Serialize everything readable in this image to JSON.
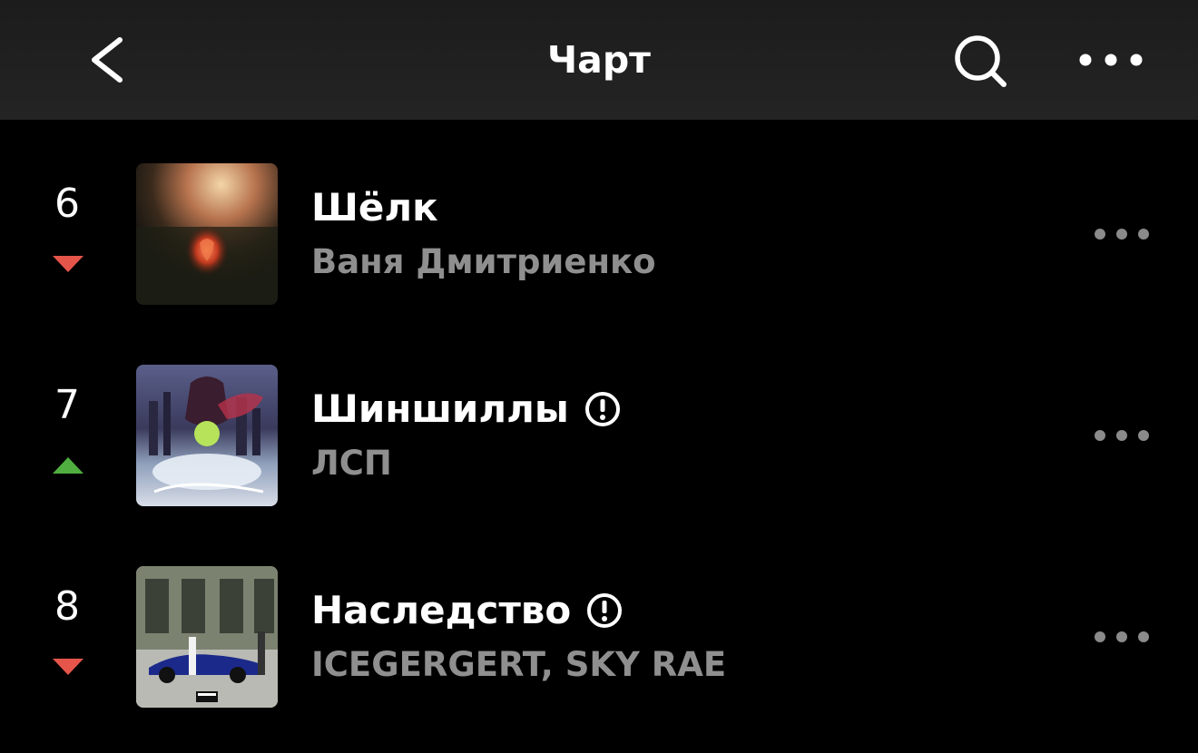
{
  "header": {
    "title": "Чарт",
    "back_icon": "chevron-left-icon",
    "search_icon": "search-icon",
    "more_icon": "more-horizontal-icon"
  },
  "tracks": [
    {
      "position": "6",
      "trend": "down",
      "title": "Шёлк",
      "artist": "Ваня Дмитриенко",
      "explicit": false
    },
    {
      "position": "7",
      "trend": "up",
      "title": "Шиншиллы",
      "artist": "ЛСП",
      "explicit": true
    },
    {
      "position": "8",
      "trend": "down",
      "title": "Наследство",
      "artist": "ICEGERGERT, SKY RAE",
      "explicit": true
    }
  ],
  "colors": {
    "background": "#000000",
    "header": "#1f1f1f",
    "text_primary": "#ffffff",
    "text_secondary": "#8f8f8f",
    "trend_down": "#e5554a",
    "trend_up": "#4fae3f",
    "more_dots": "#8a8a8a"
  }
}
